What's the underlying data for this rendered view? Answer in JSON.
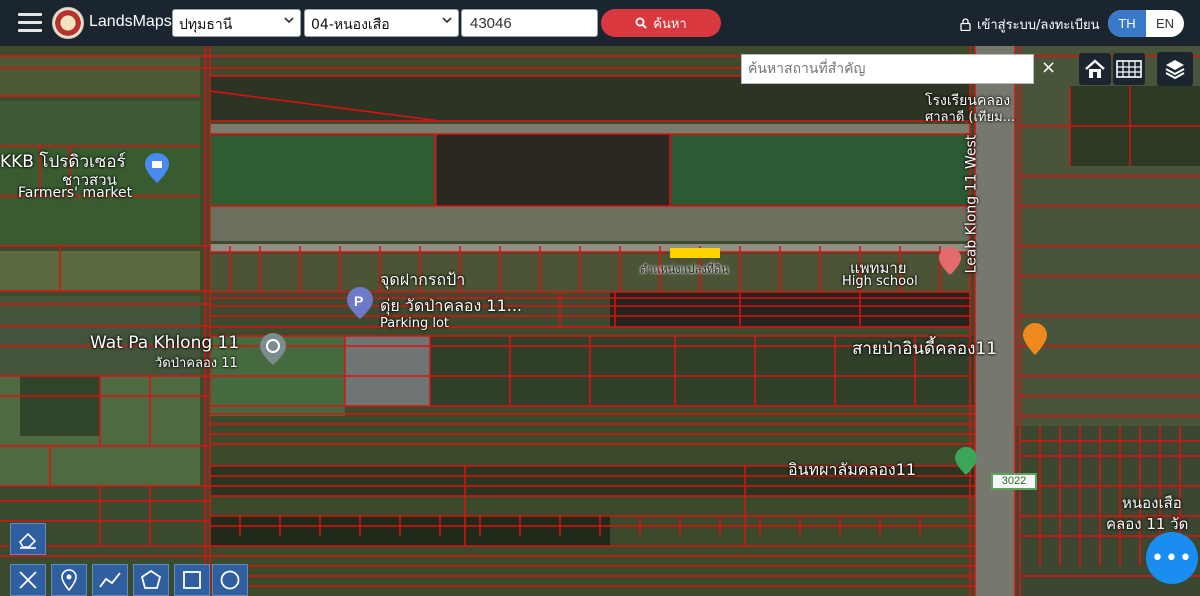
{
  "header": {
    "brand": "LandsMaps",
    "province_select": "ปทุมธานี",
    "district_select": "04-หนองเสือ",
    "parcel_input": "43046",
    "search_button": "ค้นหา",
    "login": "เข้าสู่ระบบ/ลงทะเบียน",
    "lang_th": "TH",
    "lang_en": "EN"
  },
  "map": {
    "place_search_placeholder": "ค้นหาสถานที่สำคัญ",
    "close": "×",
    "fab": "•••",
    "road_sign": "3022",
    "labels": {
      "kkb_th": "KKB โปรดิวเซอร์",
      "kkb_th2": "ชาวสวน",
      "farmers_market": "Farmers' market",
      "parcel_position": "ตำแหน่งแปลงที่ดิน",
      "parking_th": "จุดฝากรถป้า",
      "parking_th2": "ดุ่ย วัดป่าคลอง 11...",
      "parking_lot": "Parking lot",
      "wat_en": "Wat Pa Khlong 11",
      "wat_th": "วัดป่าคลอง 11",
      "high_school": "High school",
      "school_th": "แพทมาย",
      "road_leab": "Leab Klong 11 West",
      "sai_pa": "สายป่าอินดี้คลอง11",
      "inthapha": "อินทผาลัมคลอง11",
      "school_top": "โรงเรียนคลอง",
      "school_top2": "ศาลาดี (เทียม...",
      "nong_suea": "หนองเสือ",
      "khlong11": "คลอง 11 วัด"
    }
  },
  "colors": {
    "topbar": "#1b2530",
    "search": "#d9383f",
    "lang_active": "#3a78c9",
    "parcel_line": "#e01010",
    "highlight": "#ffd500",
    "fab": "#1a8ef0",
    "tool": "#2f5f9e"
  },
  "icons": {
    "menu": "hamburger-icon",
    "lock": "lock-icon",
    "search": "search-icon",
    "home": "home-icon",
    "grid": "grid-icon",
    "layers": "layers-icon",
    "eraser": "eraser-icon",
    "ruler": "ruler-icon",
    "pin": "pin-icon",
    "polyline": "polyline-icon",
    "polygon": "polygon-icon",
    "rectangle": "rectangle-icon",
    "circle": "circle-icon"
  }
}
